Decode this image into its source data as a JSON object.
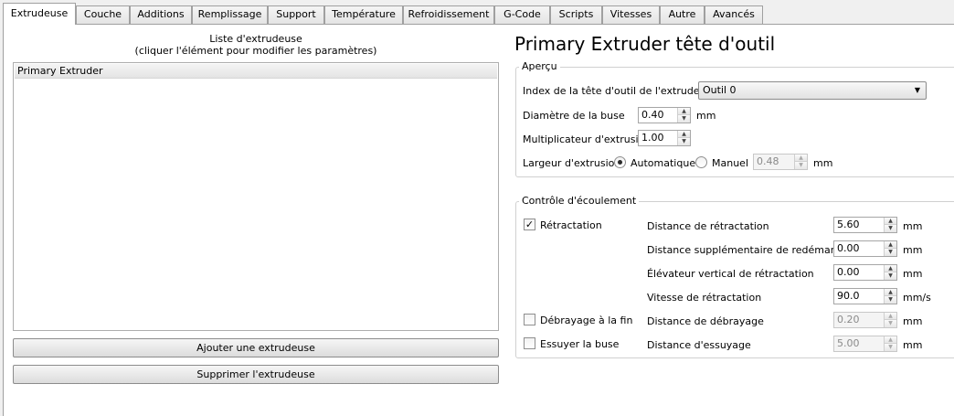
{
  "tabs": [
    {
      "label": "Extrudeuse",
      "active": true
    },
    {
      "label": "Couche"
    },
    {
      "label": "Additions"
    },
    {
      "label": "Remplissage"
    },
    {
      "label": "Support"
    },
    {
      "label": "Température"
    },
    {
      "label": "Refroidissement"
    },
    {
      "label": "G-Code"
    },
    {
      "label": "Scripts"
    },
    {
      "label": "Vitesses"
    },
    {
      "label": "Autre"
    },
    {
      "label": "Avancés"
    }
  ],
  "extruder_list": {
    "caption_line1": "Liste d'extrudeuse",
    "caption_line2": "(cliquer l'élément pour modifier les paramètres)",
    "items": [
      "Primary Extruder"
    ],
    "add_button": "Ajouter une extrudeuse",
    "remove_button": "Supprimer l'extrudeuse"
  },
  "title": "Primary Extruder tête d'outil",
  "apercu": {
    "legend": "Aperçu",
    "tool_index_label": "Index de la tête d'outil de l'extrudeuse",
    "tool_index_value": "Outil 0",
    "nozzle_label": "Diamètre de la buse",
    "nozzle_value": "0.40",
    "nozzle_unit": "mm",
    "multiplier_label": "Multiplicateur d'extrusion",
    "multiplier_value": "1.00",
    "width_label": "Largeur d'extrusion",
    "auto_label": "Automatique",
    "manual_label": "Manuel",
    "manual_value": "0.48",
    "width_unit": "mm",
    "selected_mode": "Automatique"
  },
  "flow": {
    "legend": "Contrôle d'écoulement",
    "retraction_label": "Rétractation",
    "retraction_checked": true,
    "coast_label": "Débrayage à la fin",
    "coast_checked": false,
    "wipe_label": "Essuyer la buse",
    "wipe_checked": false,
    "check_mark": "✓",
    "fields": {
      "retract_distance": {
        "label": "Distance de rétractation",
        "value": "5.60",
        "unit": "mm"
      },
      "extra_restart": {
        "label": "Distance supplémentaire de redémarrage",
        "value": "0.00",
        "unit": "mm"
      },
      "z_lift": {
        "label": "Élévateur vertical de rétractation",
        "value": "0.00",
        "unit": "mm"
      },
      "retract_speed": {
        "label": "Vitesse de rétractation",
        "value": "90.0",
        "unit": "mm/s"
      },
      "coast_distance": {
        "label": "Distance de débrayage",
        "value": "0.20",
        "unit": "mm"
      },
      "wipe_distance": {
        "label": "Distance d'essuyage",
        "value": "5.00",
        "unit": "mm"
      }
    }
  },
  "icons": {
    "spin_up": "▲",
    "spin_down": "▼",
    "combo_arrow": "▼"
  }
}
